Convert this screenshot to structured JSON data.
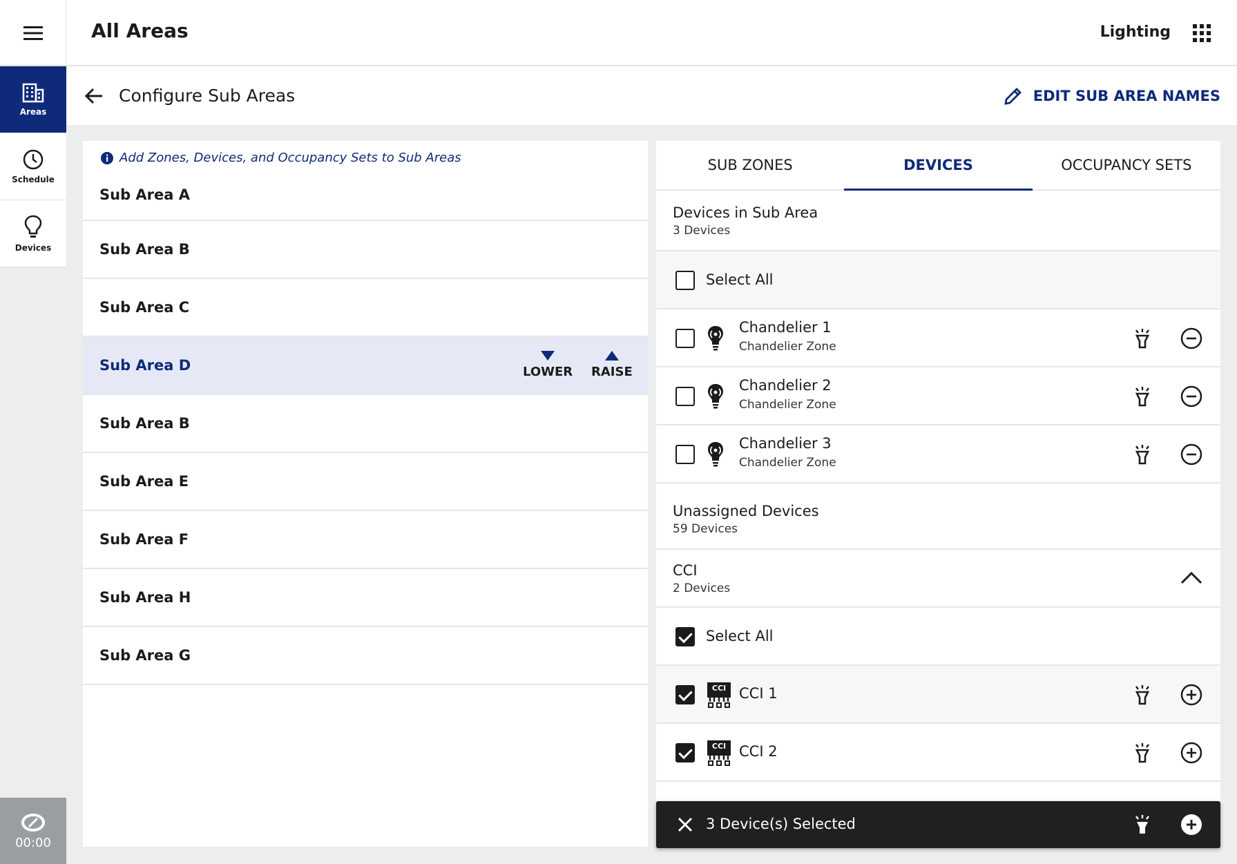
{
  "topbar": {
    "title": "All Areas",
    "app_name": "Lighting"
  },
  "sidebar": {
    "items": [
      {
        "label": "Areas"
      },
      {
        "label": "Schedule"
      },
      {
        "label": "Devices"
      }
    ],
    "sync_time": "00:00"
  },
  "subheader": {
    "title": "Configure Sub Areas",
    "edit_label": "EDIT SUB AREA NAMES"
  },
  "left": {
    "info": "Add Zones, Devices, and Occupancy Sets to Sub Areas",
    "items": [
      "Sub Area A",
      "Sub Area B",
      "Sub Area C",
      "Sub Area D",
      "Sub Area B",
      "Sub Area E",
      "Sub Area F",
      "Sub Area H",
      "Sub Area G"
    ],
    "selected_index": 3,
    "lower_label": "LOWER",
    "raise_label": "RAISE"
  },
  "tabs": [
    "SUB ZONES",
    "DEVICES",
    "OCCUPANCY SETS"
  ],
  "active_tab": 1,
  "in_sub_area": {
    "title": "Devices in Sub Area",
    "count": "3 Devices",
    "select_all": "Select All",
    "devices": [
      {
        "name": "Chandelier 1",
        "zone": "Chandelier Zone"
      },
      {
        "name": "Chandelier 2",
        "zone": "Chandelier Zone"
      },
      {
        "name": "Chandelier 3",
        "zone": "Chandelier Zone"
      }
    ]
  },
  "unassigned": {
    "title": "Unassigned Devices",
    "count": "59 Devices"
  },
  "cci_group": {
    "title": "CCI",
    "count": "2 Devices",
    "select_all": "Select All",
    "devices": [
      {
        "name": "CCI 1",
        "icon_text": "CCI"
      },
      {
        "name": "CCI 2",
        "icon_text": "CCI"
      }
    ]
  },
  "selection_bar": {
    "text": "3 Device(s) Selected"
  },
  "colors": {
    "brand": "#0f2a7a",
    "selected_row": "#e6e9f5",
    "bar": "#1f2022"
  }
}
